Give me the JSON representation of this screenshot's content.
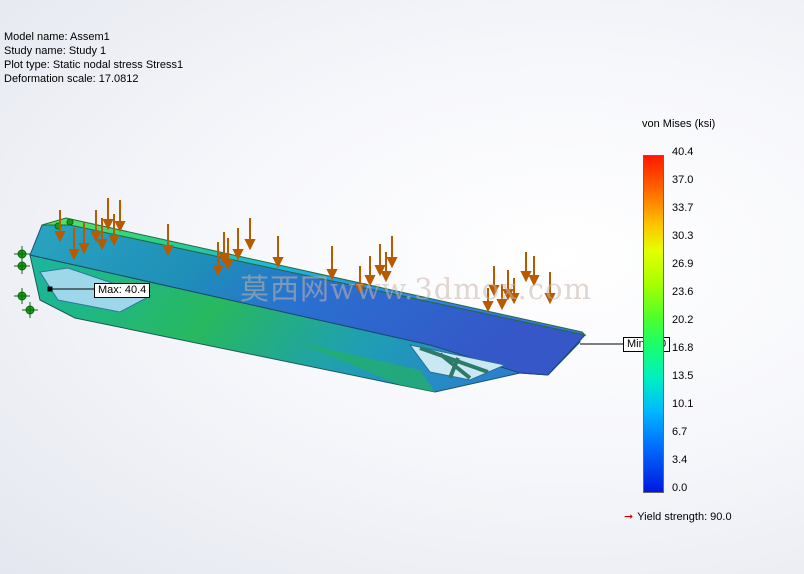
{
  "info": {
    "model_name": "Model name: Assem1",
    "study_name": "Study name: Study 1",
    "plot_type": "Plot type: Static nodal stress Stress1",
    "deformation_scale": "Deformation scale: 17.0812"
  },
  "legend": {
    "title": "von Mises (ksi)",
    "ticks": [
      "40.4",
      "37.0",
      "33.7",
      "30.3",
      "26.9",
      "23.6",
      "20.2",
      "16.8",
      "13.5",
      "10.1",
      "6.7",
      "3.4",
      "0.0"
    ],
    "yield_label": "Yield strength: 90.0",
    "gradient_colors": [
      "#ff1a00",
      "#ffc000",
      "#4fff2a",
      "#00b8ff",
      "#0018e0"
    ]
  },
  "annotations": {
    "max_label": "Max: 40.4",
    "min_label": "Min: 0.0"
  },
  "watermark": "莫西网www.3dmox.com",
  "icons": {
    "load_arrow": "down-arrow-icon",
    "fixture": "fixed-geometry-icon",
    "yield_arrow": "right-arrow-icon"
  }
}
